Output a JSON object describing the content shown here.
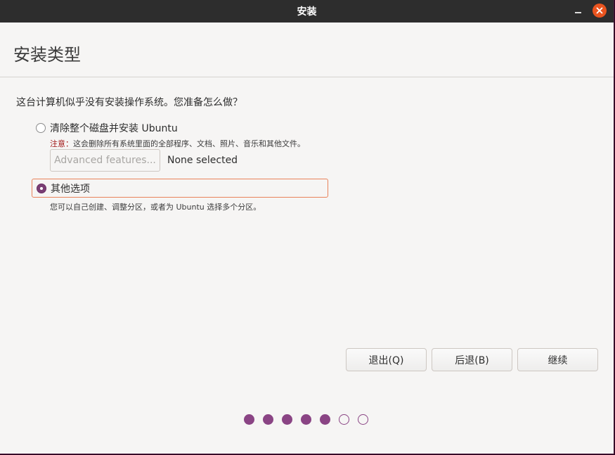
{
  "window": {
    "title": "安装"
  },
  "header": {
    "title": "安装类型"
  },
  "main": {
    "question": "这台计算机似乎没有安装操作系统。您准备怎么做？",
    "option_erase": {
      "label": "清除整个磁盘并安装 Ubuntu",
      "checked": false,
      "note_prefix": "注意：",
      "note_text": "这会删除所有系统里面的全部程序、文档、照片、音乐和其他文件。",
      "advanced_button": "Advanced features...",
      "advanced_status": "None selected"
    },
    "option_other": {
      "label": "其他选项",
      "checked": true,
      "description": "您可以自己创建、调整分区，或者为 Ubuntu 选择多个分区。"
    }
  },
  "footer": {
    "quit_label": "退出(Q)",
    "back_label": "后退(B)",
    "continue_label": "继续"
  },
  "progress": {
    "current_step": 5,
    "total_steps": 7
  },
  "colors": {
    "accent": "#8a4484",
    "focus_border": "#e9825a",
    "close_button": "#e9541f",
    "titlebar": "#2d2d2d",
    "note_prefix": "#a01515"
  }
}
